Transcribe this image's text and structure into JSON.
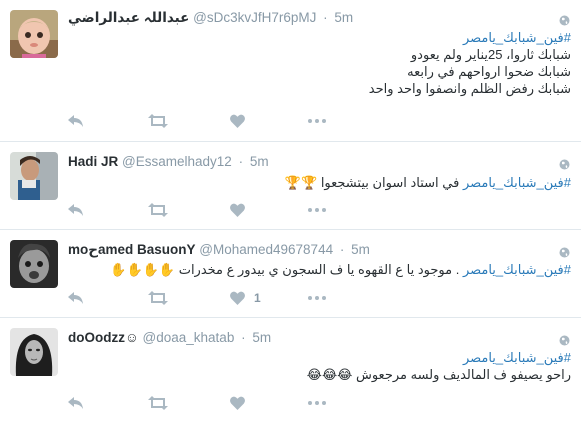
{
  "colors": {
    "link": "#2b7bb9",
    "muted": "#8899a6",
    "text": "#292f33",
    "divider": "#e1e8ed",
    "icon": "#aab8c2"
  },
  "tweets": [
    {
      "fullname": "عبداللہ عبدالراضي",
      "screen_name": "@sDc3kvJfH7r6pMJ",
      "dot": "·",
      "time": "5m",
      "hashtag": "#فين_شبابك_يامصر",
      "lines": [
        "شبابك ثاروا، 25يناير ولم يعودو",
        "شبابك ضحوا ارواحهم في رابعه",
        "شبابك رفض الظلم وانصفوا واحد واحد"
      ],
      "emoji": "",
      "like_count": "",
      "avatar_icon": "baby-face-avatar"
    },
    {
      "fullname": "Hadi JR",
      "screen_name": "@Essamelhady12",
      "dot": "·",
      "time": "5m",
      "hashtag": "#فين_شبابك_يامصر",
      "inline_text": "في استاد اسوان بيتشجعوا",
      "emoji": "🏆🏆",
      "like_count": "",
      "avatar_icon": "boy-avatar"
    },
    {
      "fullname": "moحamed BasuonY",
      "screen_name": "@Mohamed49678744",
      "dot": "·",
      "time": "5m",
      "hashtag": "#فين_شبابك_يامصر",
      "inline_text": ". موجود يا ع القهوه يا ف السجون ي بيدور ع مخدرات",
      "emoji": "✋✋✋✋",
      "like_count": "1",
      "avatar_icon": "bw-child-avatar"
    },
    {
      "fullname": "doOodzz☺",
      "screen_name": "@doaa_khatab",
      "dot": "·",
      "time": "5m",
      "hashtag": "#فين_شبابك_يامصر",
      "lines": [
        "راحو يصيفو ف المالديف ولسه مرجعوش"
      ],
      "emoji": "😂😂😂",
      "like_count": "",
      "avatar_icon": "woman-portrait-avatar"
    }
  ]
}
